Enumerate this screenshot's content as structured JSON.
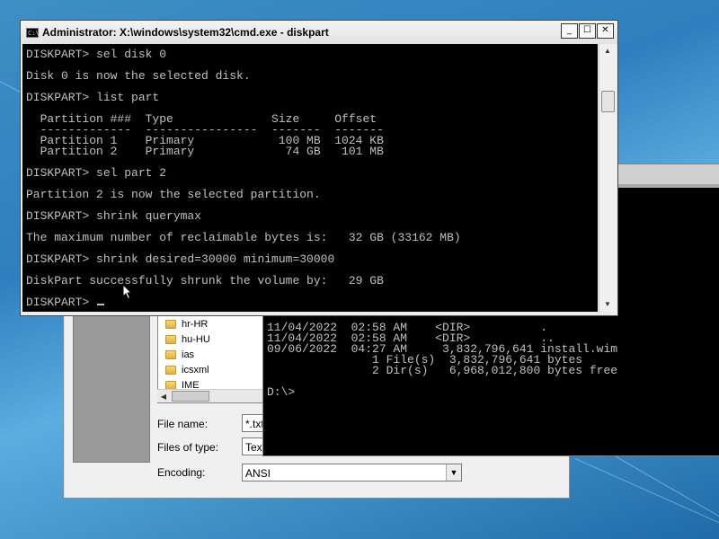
{
  "cmd_window": {
    "title": "Administrator: X:\\windows\\system32\\cmd.exe - diskpart",
    "icon": "cmd-icon",
    "buttons": {
      "minimize": "_",
      "maximize": "☐",
      "close": "✕"
    },
    "lines": [
      "DISKPART> sel disk 0",
      "",
      "Disk 0 is now the selected disk.",
      "",
      "DISKPART> list part",
      "",
      "  Partition ###  Type              Size     Offset",
      "  -------------  ----------------  -------  -------",
      "  Partition 1    Primary            100 MB  1024 KB",
      "  Partition 2    Primary             74 GB   101 MB",
      "",
      "DISKPART> sel part 2",
      "",
      "Partition 2 is now the selected partition.",
      "",
      "DISKPART> shrink querymax",
      "",
      "The maximum number of reclaimable bytes is:   32 GB (33162 MB)",
      "",
      "DISKPART> shrink desired=30000 minimum=30000",
      "",
      "DiskPart successfully shrunk the volume by:   29 GB",
      ""
    ],
    "prompt": "DISKPART> "
  },
  "dir_console": {
    "lines": [
      "11/04/2022  02:58 AM    <DIR>          .",
      "11/04/2022  02:58 AM    <DIR>          ..",
      "09/06/2022  04:27 AM     3,832,796,641 install.wim",
      "               1 File(s)  3,832,796,641 bytes",
      "               2 Dir(s)   6,968,012,800 bytes free",
      "",
      "D:\\>"
    ]
  },
  "save_dialog": {
    "folders": [
      "hr-HR",
      "hu-HU",
      "ias",
      "icsxml",
      "IME"
    ],
    "file_name_label": "File name:",
    "file_name_value": "*.txt",
    "file_type_label": "Files of type:",
    "file_type_value": "Text",
    "encoding_label": "Encoding:",
    "encoding_value": "ANSI"
  }
}
